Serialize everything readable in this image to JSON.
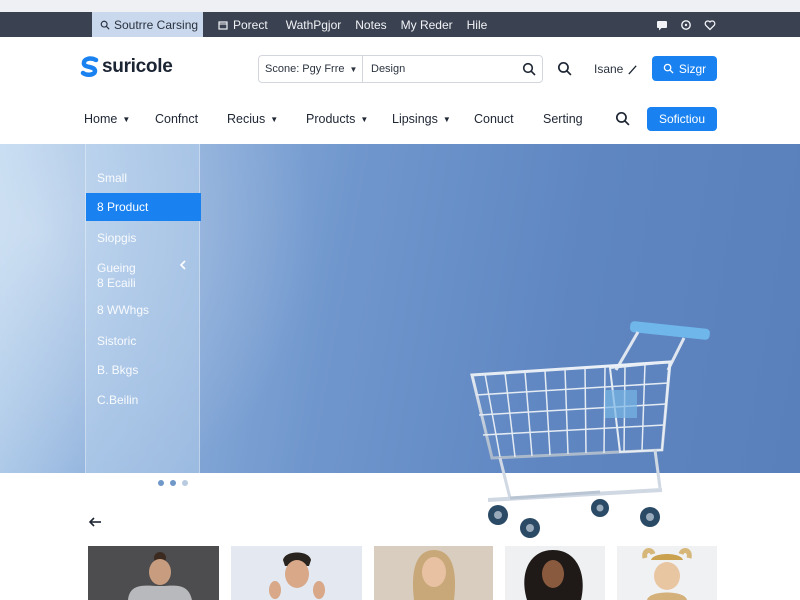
{
  "topbar": {
    "items": [
      {
        "label": "Soutrre Carsing",
        "icon": "search-icon"
      },
      {
        "label": "Porect",
        "icon": "box-icon"
      },
      {
        "label": "WathPgjor",
        "icon": ""
      },
      {
        "label": "Notes",
        "icon": ""
      },
      {
        "label": "My Reder",
        "icon": ""
      },
      {
        "label": "Hile",
        "icon": ""
      }
    ],
    "right_icons": [
      "chat-icon",
      "bell-icon",
      "heart-icon"
    ]
  },
  "header": {
    "logo_text": "suricole",
    "search": {
      "scope_label": "Scone: Pgy Frre",
      "value": "Design"
    },
    "user_label": "Isane",
    "signup_label": "Sizgr"
  },
  "nav": {
    "items": [
      {
        "label": "Home",
        "dropdown": true
      },
      {
        "label": "Confnct",
        "dropdown": false
      },
      {
        "label": "Recius",
        "dropdown": true
      },
      {
        "label": "Products",
        "dropdown": true
      },
      {
        "label": "Lipsings",
        "dropdown": true
      },
      {
        "label": "Conuct",
        "dropdown": false
      },
      {
        "label": "Serting",
        "dropdown": false
      }
    ],
    "button_label": "Sofictiou"
  },
  "hero": {
    "menu_items": [
      {
        "label": "Small",
        "active": false
      },
      {
        "label": "8 Product",
        "active": true
      },
      {
        "label": "Siopgis",
        "active": false
      },
      {
        "label": "Gueing",
        "active": false
      },
      {
        "label": "8 Ecaili",
        "active": false
      },
      {
        "label": "8 WWhgs",
        "active": false
      },
      {
        "label": "Sistoric",
        "active": false
      },
      {
        "label": "B. Bkgs",
        "active": false
      },
      {
        "label": "C.Beilin",
        "active": false
      }
    ],
    "carousel": {
      "count": 3,
      "active_index": 1
    }
  },
  "colors": {
    "accent": "#1a82f0",
    "topbar": "#3a4150",
    "hero_blue": "#6f97cc"
  }
}
